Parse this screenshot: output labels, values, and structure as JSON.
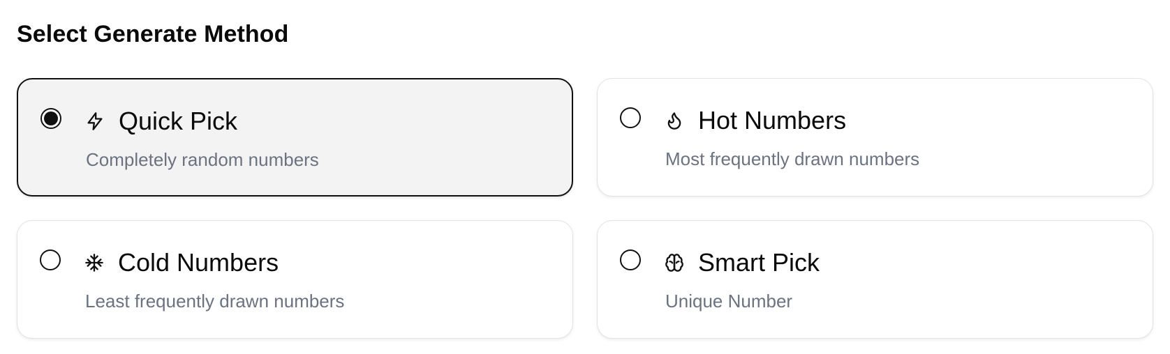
{
  "header": {
    "title": "Select Generate Method"
  },
  "methods": [
    {
      "name": "Quick Pick",
      "description": "Completely random numbers",
      "icon": "lightning-icon",
      "selected": true
    },
    {
      "name": "Hot Numbers",
      "description": "Most frequently drawn numbers",
      "icon": "flame-icon",
      "selected": false
    },
    {
      "name": "Cold Numbers",
      "description": "Least frequently drawn numbers",
      "icon": "snowflake-icon",
      "selected": false
    },
    {
      "name": "Smart Pick",
      "description": "Unique Number",
      "icon": "brain-icon",
      "selected": false
    }
  ],
  "colors": {
    "selected_background": "#f3f3f3",
    "selected_border": "#111111",
    "card_border": "#e2e2e2",
    "description_text": "#6b7280"
  }
}
